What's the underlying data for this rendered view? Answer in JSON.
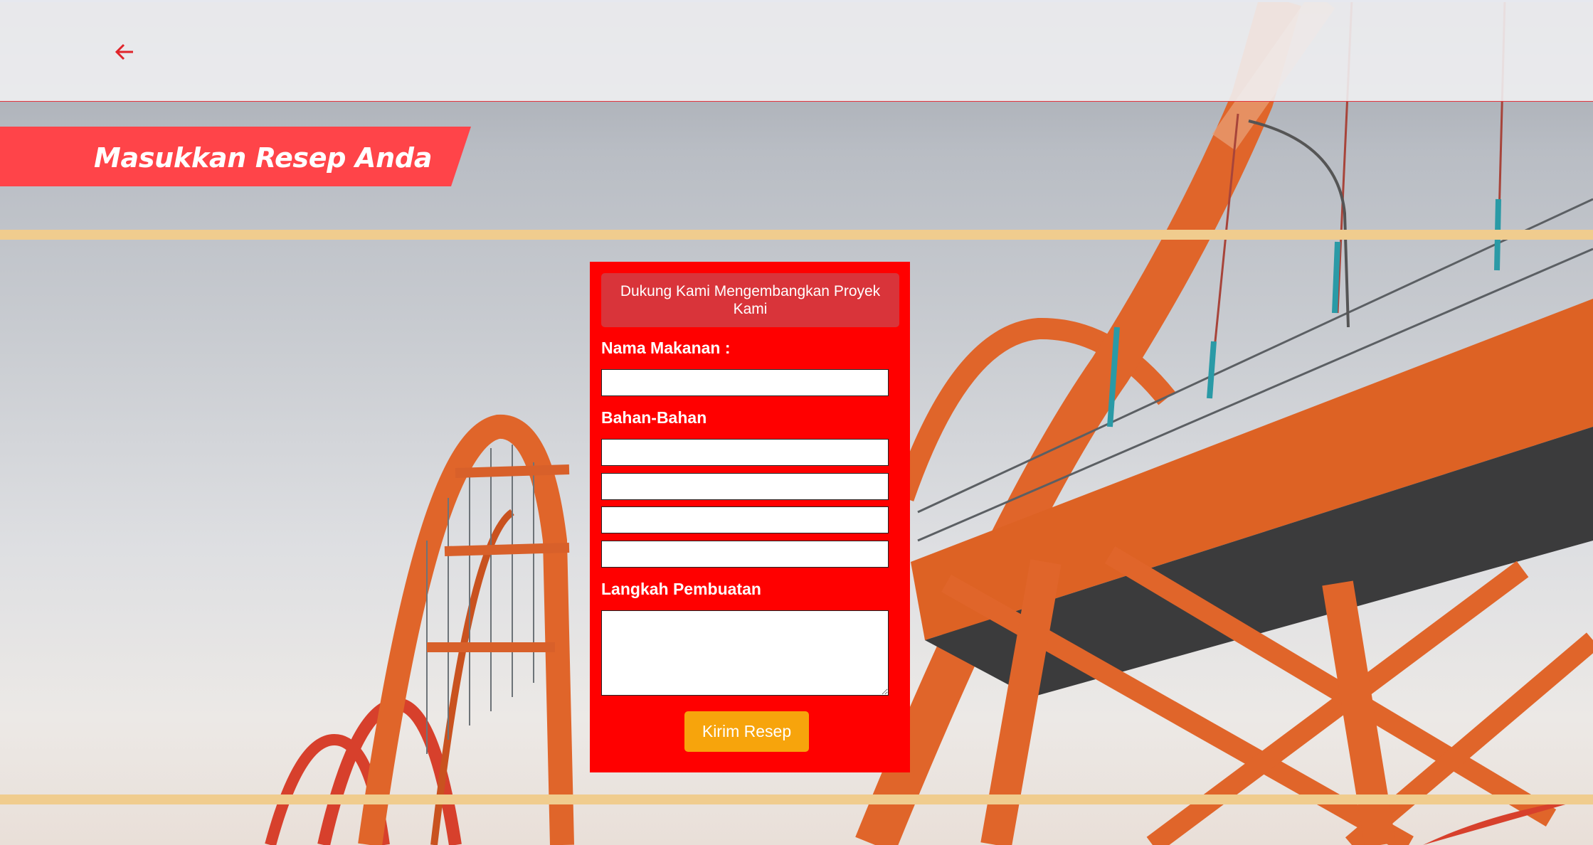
{
  "header": {
    "back_icon": "arrow-left-icon",
    "title": "Masukkan Resep Anda"
  },
  "form": {
    "support_button": "Dukung Kami Mengembangkan Proyek Kami",
    "food_name_label": "Nama Makanan :",
    "ingredients_label": "Bahan-Bahan",
    "steps_label": "Langkah Pembuatan",
    "submit_button": "Kirim Resep"
  },
  "colors": {
    "accent_red": "#ff0000",
    "banner_red": "#ff4449",
    "submit_orange": "#f7a40c",
    "divider_tan": "#f0cc8e"
  }
}
